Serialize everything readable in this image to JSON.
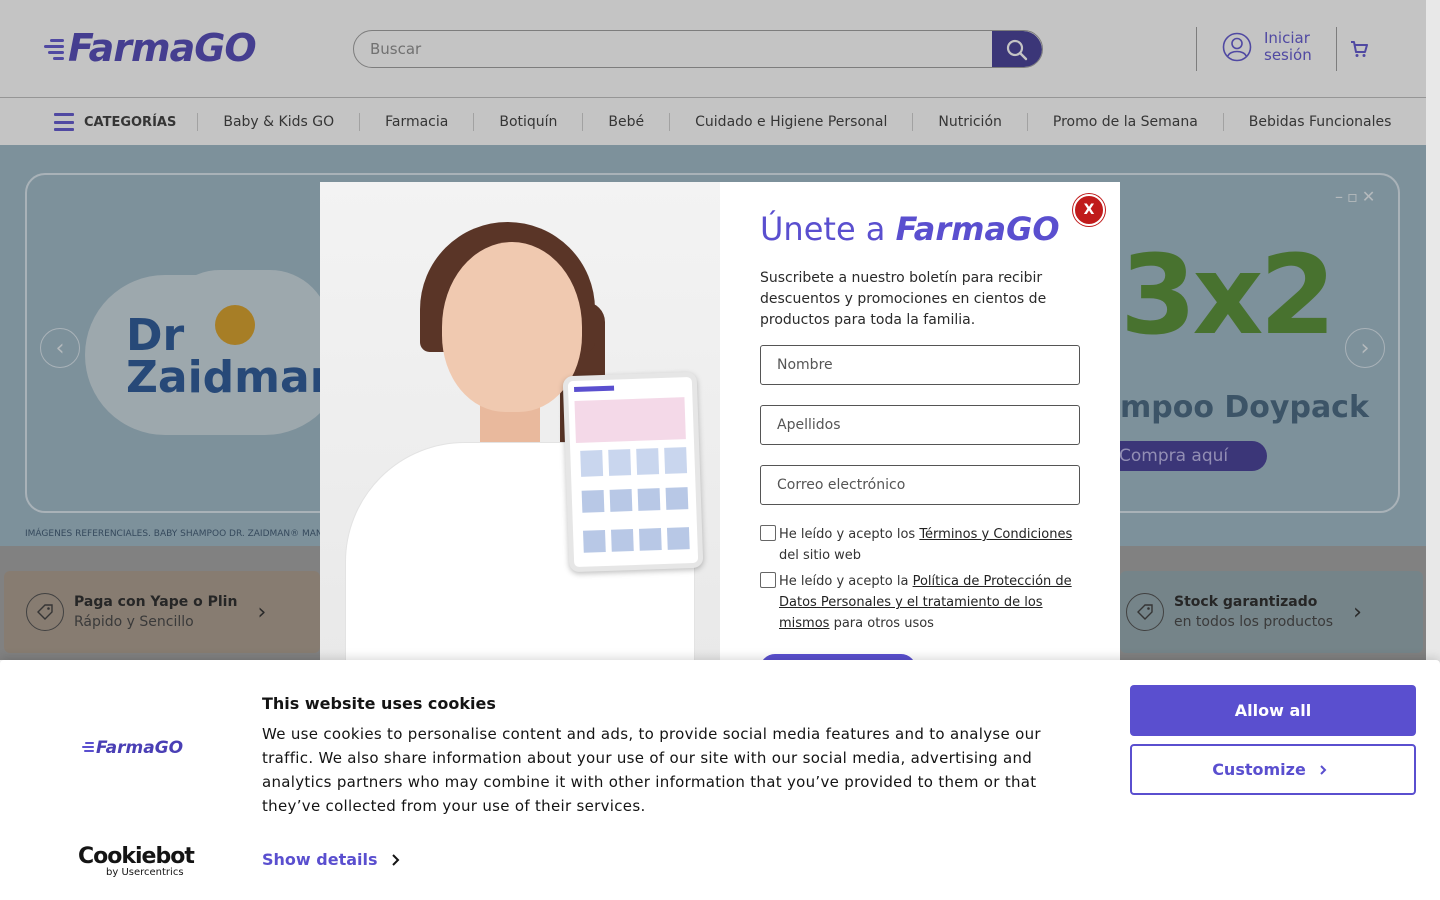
{
  "header": {
    "logo_text": "FarmaGO",
    "search_placeholder": "Buscar",
    "login_label": "Iniciar sesión"
  },
  "nav": {
    "categories_label": "CATEGORÍAS",
    "items": [
      "Baby & Kids GO",
      "Farmacia",
      "Botiquín",
      "Bebé",
      "Cuidado e Higiene Personal",
      "Nutrición",
      "Promo de la Semana",
      "Bebidas Funcionales"
    ]
  },
  "hero": {
    "brand_text": "Dr Zaidman",
    "promo_big": "3x2",
    "promo_sub": "mpoo Doypack",
    "promo_button": "Compra aquí",
    "disclaimer": "IMÁGENES REFERENCIALES. BABY SHAMPOO DR. ZAIDMAN® MANZANILL"
  },
  "benefits": [
    {
      "title": "Paga con Yape o Plin",
      "subtitle": "Rápido y Sencillo"
    },
    {
      "title": "Stock garantizado",
      "subtitle": "en todos los productos"
    }
  ],
  "modal": {
    "title_prefix": "Únete a ",
    "title_brand": "FarmaGO",
    "description": "Suscribete a nuestro boletín para recibir descuentos y promociones en cientos de productos para toda la familia.",
    "fields": {
      "name_placeholder": "Nombre",
      "lastname_placeholder": "Apellidos",
      "email_placeholder": "Correo electrónico"
    },
    "checkbox1": {
      "prefix": "He leído y acepto los ",
      "link": "Términos y Condiciones",
      "suffix": " del sitio web"
    },
    "checkbox2": {
      "prefix": "He leído y acepto la ",
      "link": "Política de Protección de Datos Personales y el tratamiento de los mismos",
      "suffix": " para otros usos"
    },
    "close_label": "X"
  },
  "cookie": {
    "logo_text": "FarmaGO",
    "title": "This website uses cookies",
    "text": "We use cookies to personalise content and ads, to provide social media features and to analyse our traffic. We also share information about your use of our site with our social media, advertising and analytics partners who may combine it with other information that you’ve provided to them or that they’ve collected from your use of their services.",
    "show_details": "Show details",
    "allow_all": "Allow all",
    "customize": "Customize",
    "cookiebot_name": "Cookiebot",
    "cookiebot_by": "by Usercentrics"
  },
  "colors": {
    "brand": "#5a4fcf",
    "brand_dark": "#3c3493",
    "close": "#c01b1b"
  }
}
